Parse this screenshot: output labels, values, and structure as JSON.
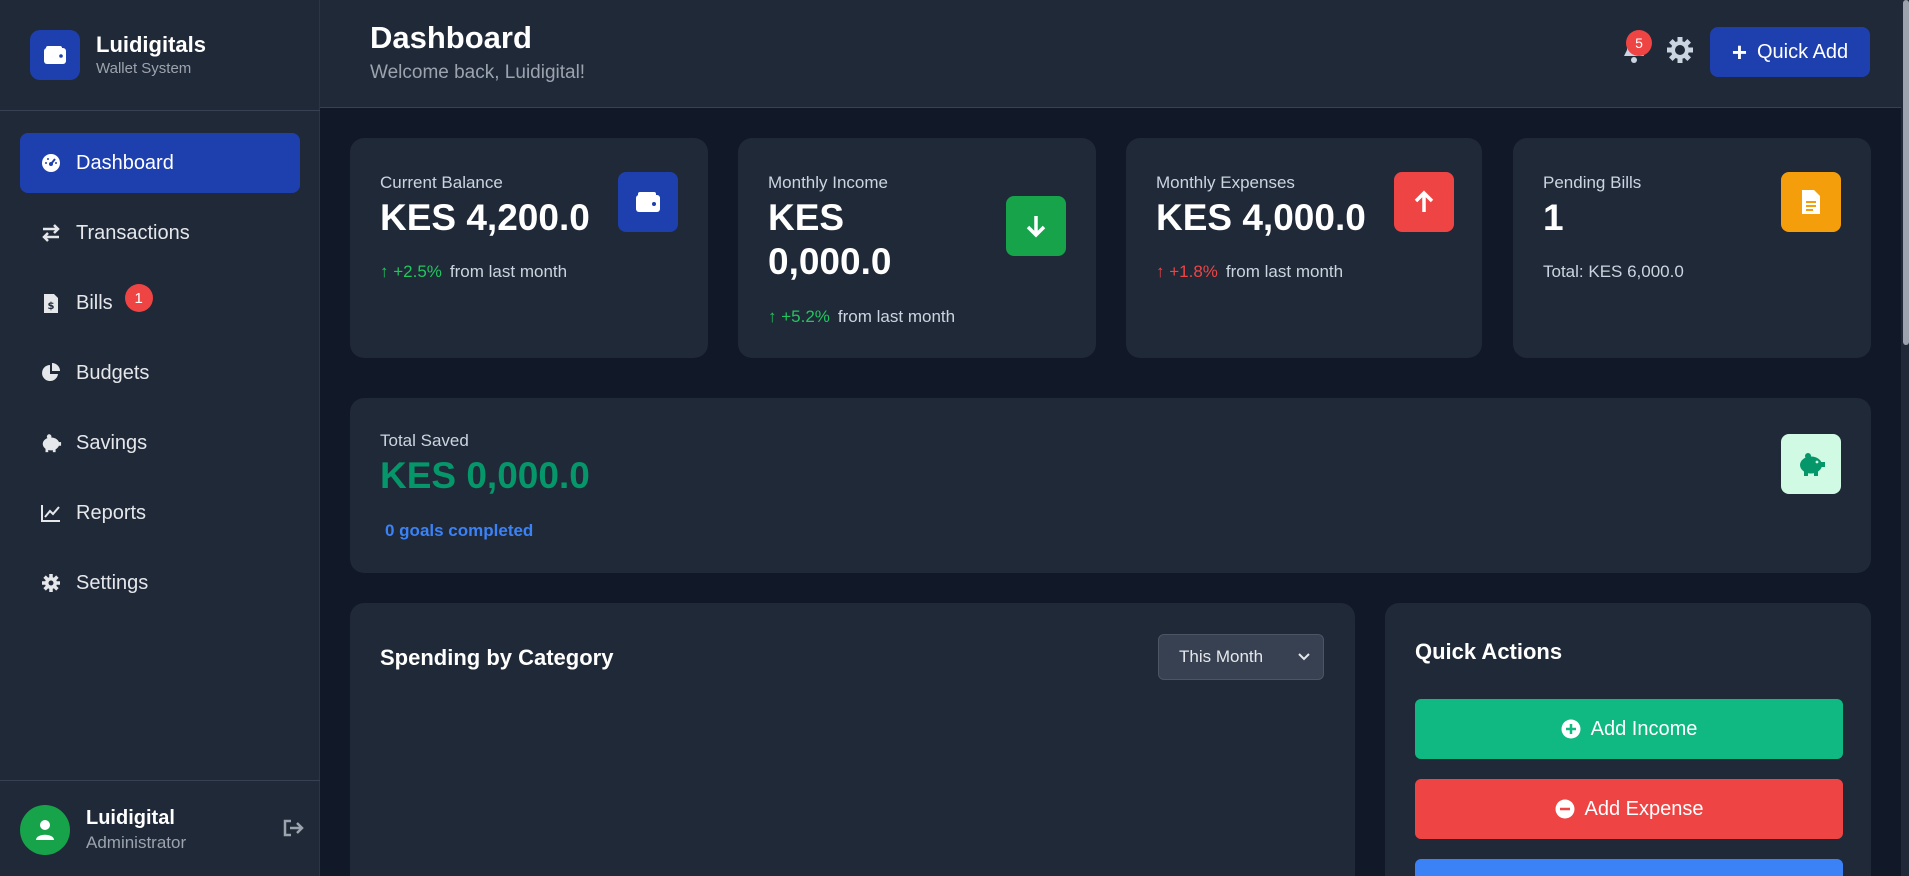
{
  "brand": {
    "name": "Luidigitals",
    "subtitle": "Wallet System"
  },
  "nav": [
    {
      "label": "Dashboard",
      "icon": "gauge-icon",
      "active": true
    },
    {
      "label": "Transactions",
      "icon": "arrows-exchange-icon"
    },
    {
      "label": "Bills",
      "icon": "invoice-dollar-icon",
      "badge": "1"
    },
    {
      "label": "Budgets",
      "icon": "pie-chart-icon"
    },
    {
      "label": "Savings",
      "icon": "piggy-bank-icon"
    },
    {
      "label": "Reports",
      "icon": "line-chart-icon"
    },
    {
      "label": "Settings",
      "icon": "gear-icon"
    }
  ],
  "user": {
    "name": "Luidigital",
    "role": "Administrator"
  },
  "header": {
    "title": "Dashboard",
    "subtitle": "Welcome back, Luidigital!",
    "notification_count": "5",
    "quick_add_label": "Quick Add"
  },
  "stats": {
    "balance": {
      "label": "Current Balance",
      "value": "KES 4,200.0",
      "change": "+2.5%",
      "change_text": "from last month"
    },
    "income": {
      "label": "Monthly Income",
      "value_line1": "KES",
      "value_line2": "0,000.0",
      "change": "+5.2%",
      "change_text": "from last month"
    },
    "expenses": {
      "label": "Monthly Expenses",
      "value": "KES 4,000.0",
      "change": "+1.8%",
      "change_text": "from last month"
    },
    "pending": {
      "label": "Pending Bills",
      "value": "1",
      "total": "Total: KES 6,000.0"
    }
  },
  "savings": {
    "label": "Total Saved",
    "value": "KES 0,000.0",
    "goals": "0 goals completed"
  },
  "spending": {
    "title": "Spending by Category",
    "period": "This Month"
  },
  "quick_actions": {
    "title": "Quick Actions",
    "add_income": "Add Income",
    "add_expense": "Add Expense"
  },
  "colors": {
    "primary": "#1e40af",
    "success": "#10b981",
    "danger": "#ef4444",
    "warning": "#f59e0b",
    "savings_green": "#059669"
  }
}
